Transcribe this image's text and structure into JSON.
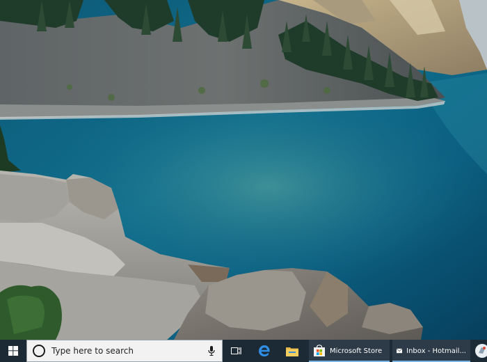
{
  "desktop": {
    "wallpaper": "lake-mountain-landscape"
  },
  "taskbar": {
    "start_icon": "windows-logo-icon",
    "search": {
      "placeholder": "Type here to search",
      "search_icon": "cortana-circle-icon",
      "mic_icon": "microphone-icon"
    },
    "pinned": [
      {
        "name": "task-view",
        "icon": "task-view-icon"
      },
      {
        "name": "edge",
        "icon": "edge-icon"
      },
      {
        "name": "file-explorer",
        "icon": "folder-icon"
      }
    ],
    "apps": [
      {
        "label": "Microsoft Store",
        "icon": "store-bag-icon",
        "active": true
      },
      {
        "label": "Inbox - Hotmail...",
        "icon": "mail-envelope-icon",
        "active": true
      }
    ],
    "tray_icon": "app-tray-icon",
    "colors": {
      "background": "#1c2a36",
      "accent": "#79b4e6"
    }
  }
}
